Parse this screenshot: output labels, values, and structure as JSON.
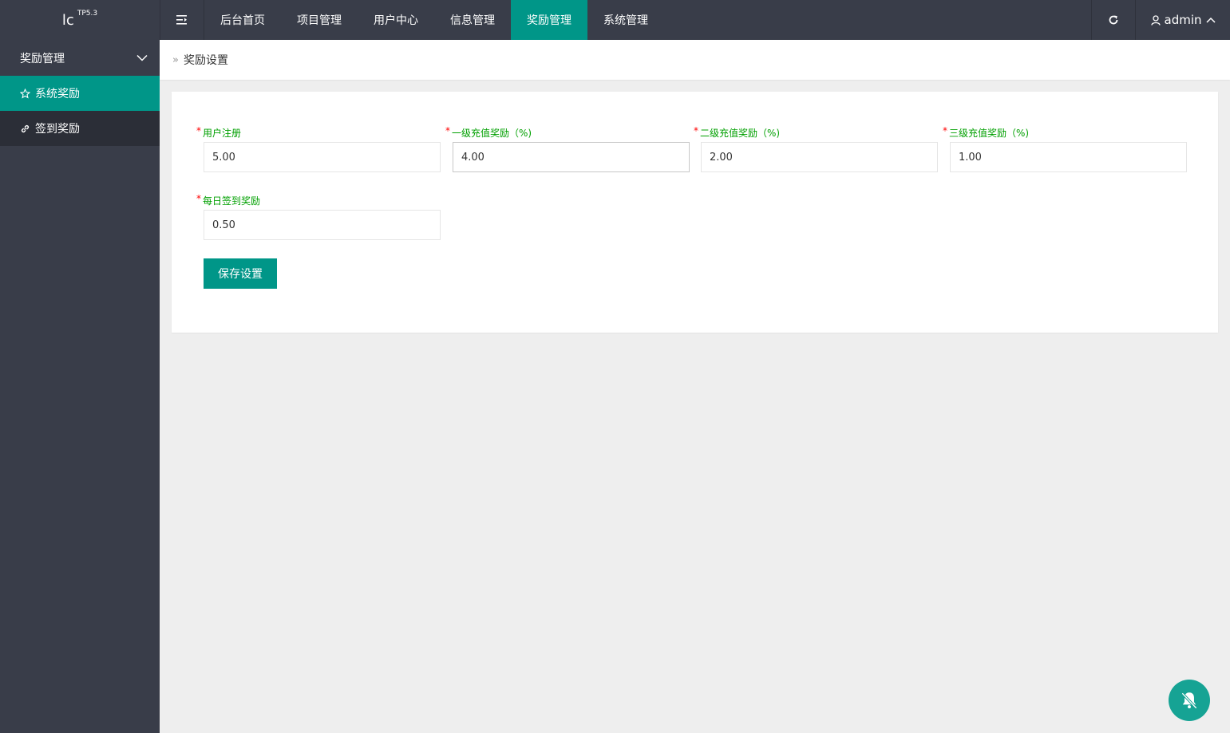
{
  "header": {
    "logo_main": "lc",
    "logo_sup": "TP5.3",
    "nav": [
      {
        "label": "后台首页"
      },
      {
        "label": "项目管理"
      },
      {
        "label": "用户中心"
      },
      {
        "label": "信息管理"
      },
      {
        "label": "奖励管理"
      },
      {
        "label": "系统管理"
      }
    ],
    "user_name": "admin"
  },
  "sidebar": {
    "group_label": "奖励管理",
    "items": [
      {
        "label": "系统奖励",
        "icon": "star-icon"
      },
      {
        "label": "签到奖励",
        "icon": "link-icon"
      }
    ]
  },
  "breadcrumb": {
    "current": "奖励设置"
  },
  "form": {
    "fields": [
      {
        "label": "用户注册",
        "value": "5.00"
      },
      {
        "label": "一级充值奖励（%)",
        "value": "4.00"
      },
      {
        "label": "二级充值奖励（%)",
        "value": "2.00"
      },
      {
        "label": "三级充值奖励（%)",
        "value": "1.00"
      },
      {
        "label": "每日签到奖励",
        "value": "0.50"
      }
    ],
    "required_mark": "*",
    "save_label": "保存设置"
  },
  "colors": {
    "accent": "#009688",
    "dark": "#393d49",
    "label_green": "#00a000",
    "required_red": "#ff0000"
  }
}
